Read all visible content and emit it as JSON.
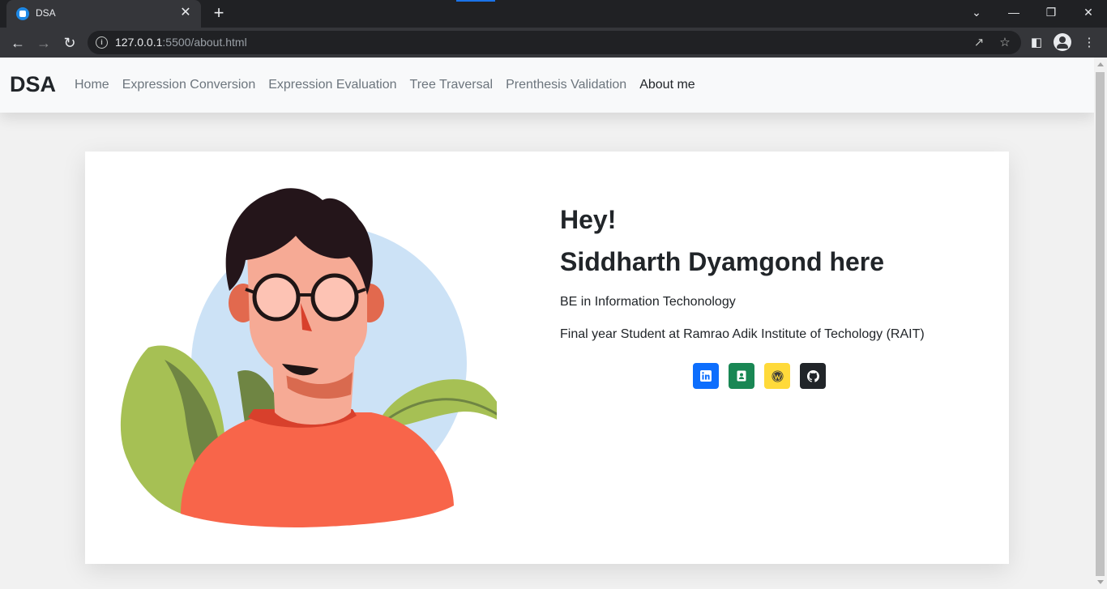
{
  "browser": {
    "tab_title": "DSA",
    "tab_close": "✕",
    "new_tab": "+",
    "url_host": "127.0.0.1",
    "url_path": ":5500/about.html",
    "window_controls": [
      "⌄",
      "—",
      "❐",
      "✕"
    ]
  },
  "site": {
    "brand": "DSA",
    "nav": [
      "Home",
      "Expression Conversion",
      "Expression Evaluation",
      "Tree Traversal",
      "Prenthesis Validation",
      "About me"
    ],
    "active_nav": "About me"
  },
  "about": {
    "greeting": "Hey!",
    "name_line": "Siddharth Dyamgond here",
    "degree": "BE in Information Techonology",
    "college": "Final year Student at Ramrao Adik Institute of Techology (RAIT)"
  },
  "social": [
    {
      "icon": "linkedin-icon",
      "color": "#0d6efd"
    },
    {
      "icon": "contact-card-icon",
      "color": "#198754"
    },
    {
      "icon": "wordpress-icon",
      "color": "#ffda3a"
    },
    {
      "icon": "github-icon",
      "color": "#212529"
    }
  ]
}
